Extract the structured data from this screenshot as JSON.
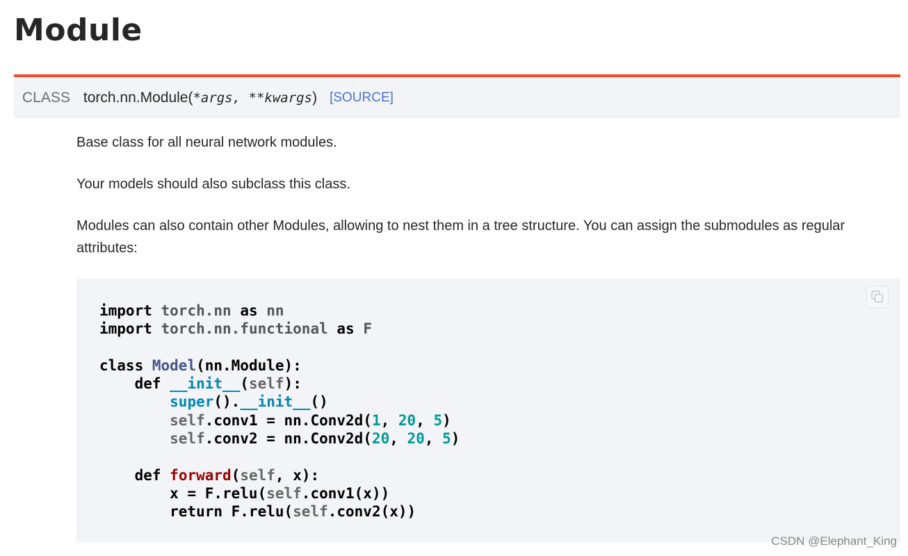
{
  "page": {
    "title": "Module"
  },
  "signature": {
    "keyword": "CLASS",
    "name": "torch.nn.Module",
    "open_paren": "(",
    "params": "*args, **kwargs",
    "close_paren": ")",
    "source_link": "[SOURCE]",
    "accent_color": "#ee4c2c"
  },
  "description": {
    "p1": "Base class for all neural network modules.",
    "p2": "Your models should also subclass this class.",
    "p3": "Modules can also contain other Modules, allowing to nest them in a tree structure. You can assign the submodules as regular attributes:"
  },
  "code": {
    "copy_icon": "copy-icon",
    "lines": [
      "import torch.nn as nn",
      "import torch.nn.functional as F",
      "",
      "class Model(nn.Module):",
      "    def __init__(self):",
      "        super().__init__()",
      "        self.conv1 = nn.Conv2d(1, 20, 5)",
      "        self.conv2 = nn.Conv2d(20, 20, 5)",
      "",
      "    def forward(self, x):",
      "        x = F.relu(self.conv1(x))",
      "        return F.relu(self.conv2(x))"
    ]
  },
  "watermark": "CSDN @Elephant_King"
}
